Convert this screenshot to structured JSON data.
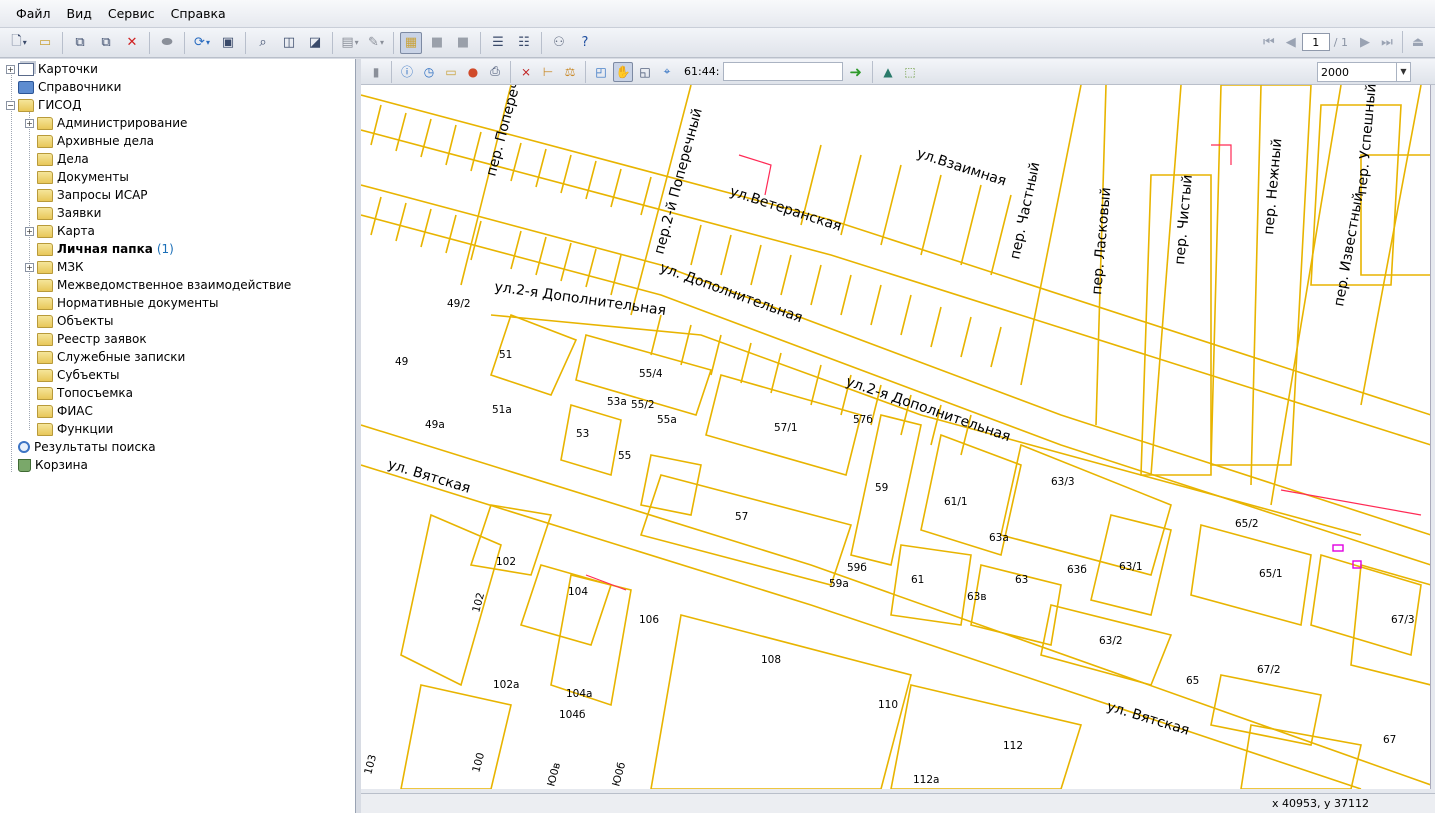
{
  "menu": [
    {
      "label": "Файл",
      "name": "menu-file"
    },
    {
      "label": "Вид",
      "name": "menu-view"
    },
    {
      "label": "Сервис",
      "name": "menu-service"
    },
    {
      "label": "Справка",
      "name": "menu-help"
    }
  ],
  "toolbar": {
    "icons": [
      "new-document-icon",
      "open-folder-icon",
      "copy-icon",
      "paste-icon",
      "delete-icon",
      "print-icon",
      "refresh-icon",
      "properties-icon",
      "find-icon",
      "zoom-icon",
      "zoom-extent-icon",
      "layers-icon",
      "tools-icon",
      "view-card-icon",
      "view-gray-icon",
      "view-dark-icon",
      "list-view-icon",
      "details-view-icon",
      "users-icon",
      "help-icon"
    ],
    "pager": {
      "page": "1",
      "total": "/ 1"
    }
  },
  "tree": [
    {
      "label": "Карточки",
      "icon": "cards-icon",
      "level": 0,
      "pm": "+"
    },
    {
      "label": "Справочники",
      "icon": "book-icon",
      "level": 0,
      "pm": ""
    },
    {
      "label": "ГИСОД",
      "icon": "folder-icon",
      "level": 0,
      "pm": "-"
    },
    {
      "label": "Администрирование",
      "icon": "folder-icon",
      "level": 1,
      "pm": "+"
    },
    {
      "label": "Архивные дела",
      "icon": "folder-icon",
      "level": 1,
      "pm": ""
    },
    {
      "label": "Дела",
      "icon": "folder-icon",
      "level": 1,
      "pm": ""
    },
    {
      "label": "Документы",
      "icon": "folder-icon",
      "level": 1,
      "pm": ""
    },
    {
      "label": "Запросы ИСАР",
      "icon": "folder-icon",
      "level": 1,
      "pm": ""
    },
    {
      "label": "Заявки",
      "icon": "folder-icon",
      "level": 1,
      "pm": ""
    },
    {
      "label": "Карта",
      "icon": "folder-icon",
      "level": 1,
      "pm": "+"
    },
    {
      "label": "Личная папка",
      "icon": "folder-icon",
      "level": 1,
      "pm": "",
      "bold": true,
      "count": "(1)"
    },
    {
      "label": "МЗК",
      "icon": "folder-icon",
      "level": 1,
      "pm": "+"
    },
    {
      "label": "Межведомственное взаимодействие",
      "icon": "folder-icon",
      "level": 1,
      "pm": ""
    },
    {
      "label": "Нормативные документы",
      "icon": "folder-icon",
      "level": 1,
      "pm": ""
    },
    {
      "label": "Объекты",
      "icon": "folder-icon",
      "level": 1,
      "pm": ""
    },
    {
      "label": "Реестр заявок",
      "icon": "folder-icon",
      "level": 1,
      "pm": ""
    },
    {
      "label": "Служебные записки",
      "icon": "folder-icon",
      "level": 1,
      "pm": ""
    },
    {
      "label": "Субъекты",
      "icon": "folder-icon",
      "level": 1,
      "pm": ""
    },
    {
      "label": "Топосъемка",
      "icon": "folder-icon",
      "level": 1,
      "pm": ""
    },
    {
      "label": "ФИАС",
      "icon": "folder-icon",
      "level": 1,
      "pm": ""
    },
    {
      "label": "Функции",
      "icon": "folder-icon",
      "level": 1,
      "pm": ""
    },
    {
      "label": "Результаты поиска",
      "icon": "search-results-icon",
      "level": 0,
      "pm": ""
    },
    {
      "label": "Корзина",
      "icon": "recycle-bin-icon",
      "level": 0,
      "pm": ""
    }
  ],
  "mapbar": {
    "coord_label": "61:44:",
    "coord_value": "",
    "scale": "2000",
    "icons": [
      "pin-icon",
      "info-icon",
      "clock-icon",
      "open-map-icon",
      "layers-color-icon",
      "print-map-icon",
      "clear-selection-icon",
      "measure-icon",
      "scale-icon",
      "zoom-window-icon",
      "pan-icon",
      "select-icon",
      "locate-icon"
    ]
  },
  "map": {
    "streets": [
      "ул.Взаимная",
      "ул.Ветеранская",
      "ул. Дополнительная",
      "ул.2-я Дополнительная",
      "ул.2-я Дополнительная",
      "ул. Вятская",
      "ул. Вятская",
      "пер. Поперечный",
      "пер.2-й Поперечный",
      "пер. Частный",
      "пер. Ласковый",
      "пер. Чистый",
      "пер. Нежный",
      "пер. Известный",
      "пер. Успешный"
    ],
    "labels": [
      "49/2",
      "49",
      "51",
      "51а",
      "49а",
      "55/4",
      "53а",
      "55/2",
      "55а",
      "53",
      "55",
      "57/1",
      "57б",
      "57",
      "59",
      "59б",
      "59а",
      "61/1",
      "63/3",
      "63а",
      "63б",
      "63/1",
      "61",
      "63в",
      "63",
      "63/2",
      "65/2",
      "65/1",
      "67/3",
      "67/2",
      "65",
      "67",
      "102",
      "102",
      "102а",
      "104",
      "104а",
      "104б",
      "106",
      "108",
      "110",
      "112",
      "112а",
      "100",
      "103",
      "Ю0в",
      "Ю0б"
    ]
  },
  "status": {
    "coords": "x 40953, y 37112"
  }
}
